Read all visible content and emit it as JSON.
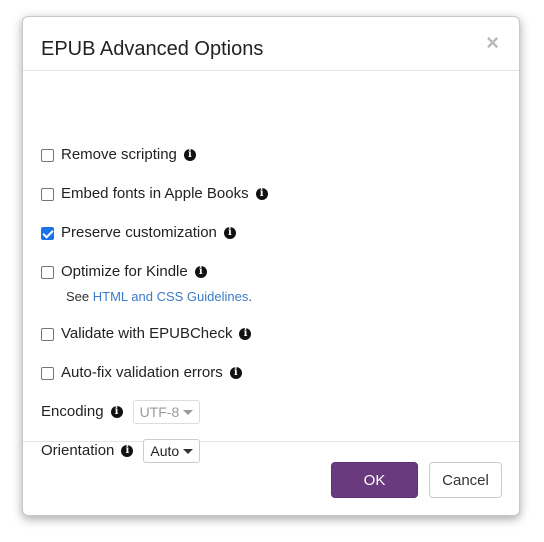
{
  "dialog": {
    "title": "EPUB Advanced Options",
    "close_label": "×"
  },
  "options": [
    {
      "label": "Remove scripting",
      "checked": false
    },
    {
      "label": "Embed fonts in Apple Books",
      "checked": false
    },
    {
      "label": "Preserve customization",
      "checked": true
    },
    {
      "label": "Optimize for Kindle",
      "checked": false
    },
    {
      "label": "Validate with EPUBCheck",
      "checked": false
    },
    {
      "label": "Auto-fix validation errors",
      "checked": false
    }
  ],
  "kindle_note": {
    "prefix": "See ",
    "link": "HTML and CSS Guidelines",
    "suffix": "."
  },
  "encoding": {
    "label": "Encoding",
    "value": "UTF-8",
    "disabled": true
  },
  "orientation": {
    "label": "Orientation",
    "value": "Auto"
  },
  "footer": {
    "ok_label": "OK",
    "cancel_label": "Cancel"
  },
  "colors": {
    "primary": "#6a3a7f",
    "checkbox_checked": "#1a73e8",
    "link": "#3a7cc7"
  },
  "icons": {
    "info": "info-circle-icon",
    "close": "close-icon",
    "caret": "caret-down-icon"
  }
}
